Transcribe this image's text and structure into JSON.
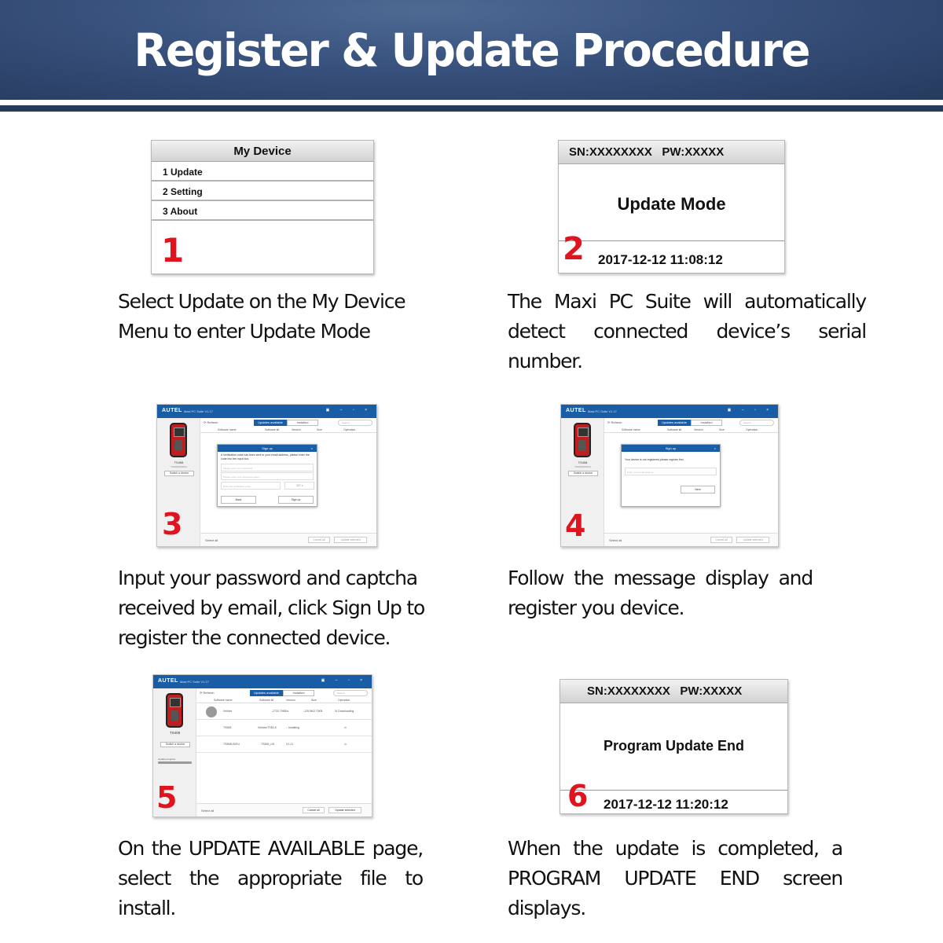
{
  "banner": {
    "title": "Register & Update Procedure",
    "colors": {
      "navy": "#263a5e",
      "number_red": "#e0141e",
      "window_blue": "#1a5da7"
    }
  },
  "steps": [
    {
      "number": "1",
      "screen": {
        "title": "My Device",
        "items": [
          "1 Update",
          "2 Setting",
          "3 About"
        ]
      },
      "caption": "Select Update on the My Device Menu to enter Update Mode"
    },
    {
      "number": "2",
      "screen": {
        "header": "SN:XXXXXXXX   PW:XXXXX",
        "message": "Update Mode",
        "timestamp": "2017-12-12 11:08:12"
      },
      "caption": "The Maxi PC Suite will automatically detect connected device’s serial number."
    },
    {
      "number": "3",
      "window": {
        "logo": "AUTEL",
        "app_title": "Maxi PC Suite V1.17",
        "controls": "▣ – ▫ ×",
        "device_name": "TS408",
        "device_sub": "TS408(200001)",
        "switch_device": "Switch a device",
        "refresh": "⟳ Refresh",
        "tab_active": "Updates available",
        "tab_inactive": "Installed",
        "search_placeholder": "Search",
        "columns": [
          "Software name",
          "Software kit",
          "Version",
          "Size",
          "Operation"
        ],
        "select_all": "Select all",
        "cancel_all": "Cancel all",
        "update_selected": "Update selected",
        "dialog": {
          "title": "Sign up",
          "close": "×",
          "message": "A verification code has been sent to your email address, please enter the code into the input box.",
          "password_placeholder": "Please enter your password",
          "password_again_placeholder": "Please enter your password again...",
          "code_placeholder": "Enter the verification code",
          "countdown": "367 s",
          "back": "Back",
          "signup": "Sign up"
        }
      },
      "caption": "Input your password and captcha received by email, click Sign Up to register the connected device."
    },
    {
      "number": "4",
      "window": {
        "logo": "AUTEL",
        "app_title": "Maxi PC Suite V1.17",
        "controls": "▣ – ▫ ×",
        "device_name": "TS408",
        "device_sub": "TS408(200001)",
        "switch_device": "Switch a device",
        "refresh": "⟳ Refresh",
        "tab_active": "Updates available",
        "tab_inactive": "Installed",
        "search_placeholder": "Search",
        "columns": [
          "Software name",
          "Software kit",
          "Version",
          "Size",
          "Operation"
        ],
        "select_all": "Select all",
        "cancel_all": "Cancel all",
        "update_selected": "Update selected",
        "dialog": {
          "title": "Sign up",
          "close": "×",
          "message": "Your device is not registered,please register first",
          "email_placeholder": "Enter your email address",
          "next": "Next"
        }
      },
      "caption": "Follow the message display and register you device."
    },
    {
      "number": "5",
      "window": {
        "logo": "AUTEL",
        "app_title": "Maxi PC Suite V1.17",
        "controls": "▣ – ▫ ×",
        "device_name": "TS408",
        "switch_device": "Switch a device",
        "progress_label": "Update progress",
        "refresh": "⟳ Refresh",
        "tab_active": "Updates available",
        "tab_inactive": "Installed",
        "search_placeholder": "Search",
        "columns": [
          "Software name",
          "Software kit",
          "Version",
          "Size",
          "Operation"
        ],
        "rows": [
          {
            "name": "Vehicle",
            "kit": "",
            "version": "-2732.79KB/s",
            "size": "-125.56/2.73KB",
            "operation": "☒ Downloading"
          },
          {
            "name": "TS508",
            "kit": "Vehicle/TS50 8",
            "version": "◌ Installing",
            "size": "",
            "operation": "⊙"
          },
          {
            "name": "TS508US/EU",
            "kit": "TS508_US",
            "version": "V1.21",
            "size": "",
            "operation": "⊙"
          }
        ],
        "select_all": "Select all",
        "cancel_all": "Cancel all",
        "update_selected": "Update selected"
      },
      "caption": "On the UPDATE AVAILABLE page, select the appropriate file to install."
    },
    {
      "number": "6",
      "screen": {
        "header": "SN:XXXXXXXX   PW:XXXXX",
        "message": "Program Update End",
        "timestamp": "2017-12-12 11:20:12"
      },
      "caption": "When the update is completed, a PROGRAM UPDATE END screen displays."
    }
  ]
}
